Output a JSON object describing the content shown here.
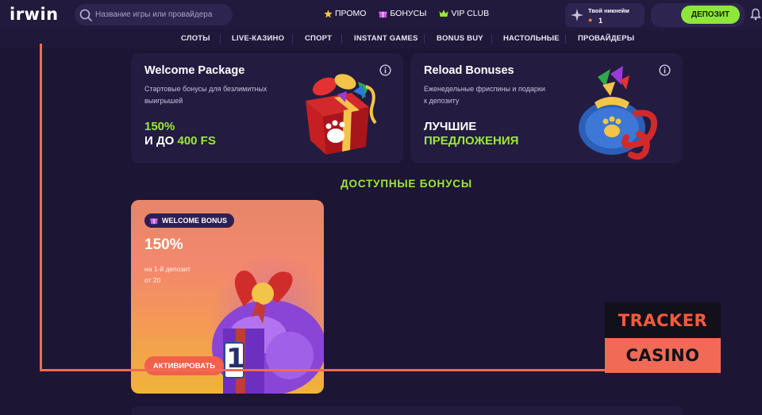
{
  "header": {
    "logo": "irwin",
    "search_placeholder": "Название игры или провайдера",
    "nav": [
      {
        "label": "ПРОМО",
        "icon": "star-icon"
      },
      {
        "label": "БОНУСЫ",
        "icon": "gift-icon"
      },
      {
        "label": "VIP CLUB",
        "icon": "crown-icon"
      }
    ],
    "profile": {
      "nickname": "Твой никнейм",
      "level": "1"
    },
    "deposit_label": "ДЕПОЗИТ"
  },
  "categories": [
    "СЛОТЫ",
    "LIVE-КАЗИНО",
    "СПОРТ",
    "INSTANT GAMES",
    "BONUS BUY",
    "НАСТОЛЬНЫЕ",
    "ПРОВАЙДЕРЫ"
  ],
  "promos": [
    {
      "title": "Welcome Package",
      "description_line1": "Стартовые бонусы для безлимитных",
      "description_line2": "выигрышей",
      "highlight_line1": "150%",
      "highlight_line2_prefix": "И ДО",
      "highlight_line2_value": "400 FS"
    },
    {
      "title": "Reload Bonuses",
      "description_line1": "Еженедельные фриспины и подарки",
      "description_line2": "к депозиту",
      "highlight_line1": "ЛУЧШИЕ",
      "highlight_line2_value": "ПРЕДЛОЖЕНИЯ"
    }
  ],
  "section_title": "ДОСТУПНЫЕ БОНУСЫ",
  "bonus_card": {
    "badge": "WELCOME BONUS",
    "percent": "150%",
    "desc_line1": "на 1-й депозит",
    "desc_line2": "от 20",
    "gift_number": "1",
    "button": "АКТИВИРОВАТЬ"
  },
  "watermark": {
    "line1": "TRACKER",
    "line2": "CASINO"
  },
  "colors": {
    "background": "#1c1533",
    "accent_green": "#9be83a",
    "deposit_button": "#8ee63a",
    "activate_button": "#f0604a",
    "watermark_accent": "#f06a56"
  }
}
